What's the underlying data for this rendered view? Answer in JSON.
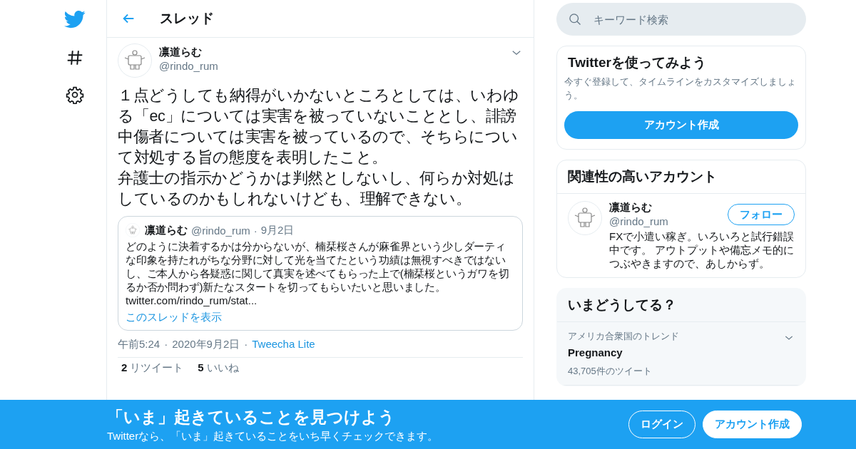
{
  "nav": [
    {
      "kind": "logo"
    },
    {
      "kind": "explore"
    },
    {
      "kind": "settings"
    }
  ],
  "header": {
    "title": "スレッド"
  },
  "tweet": {
    "name": "凛道らむ",
    "handle": "@rindo_rum",
    "paragraphs": [
      "１点どうしても納得がいかないところとしては、いわゆる「ec」については実害を被っていないこととし、誹謗中傷者については実害を被っているので、そちらについて対処する旨の態度を表明したこと。",
      "弁護士の指示かどうかは判然としないし、何らか対処はしているのかもしれないけども、理解できない。"
    ],
    "separator": "·",
    "quote": {
      "name": "凛道らむ",
      "handle": "@rindo_rum",
      "date": "9月2日",
      "text": "どのように決着するかは分からないが、楠栞桜さんが麻雀界という少しダーティな印象を持たれがちな分野に対して光を当てたという功績は無視すべきではないし、ご本人から各疑惑に関して真実を述べてもらった上で(楠栞桜というガワを切るか否か問わず)新たなスタートを切ってもらいたいと思いました。",
      "link": "twitter.com/rindo_rum/stat...",
      "thread_link": "このスレッドを表示"
    },
    "time": "午前5:24",
    "date": "2020年9月2日",
    "source": "Tweecha Lite",
    "stats": [
      {
        "count": "2",
        "label": "リツイート"
      },
      {
        "count": "5",
        "label": "いいね"
      }
    ]
  },
  "search": {
    "placeholder": "キーワード検索"
  },
  "signup_card": {
    "title": "Twitterを使ってみよう",
    "text": "今すぐ登録して、タイムラインをカスタマイズしましょう。",
    "button": "アカウント作成"
  },
  "related": {
    "title": "関連性の高いアカウント",
    "accounts": [
      {
        "name": "凛道らむ",
        "handle": "@rindo_rum",
        "button": "フォロー",
        "bio": "FXで小遣い稼ぎ。いろいろと試行錯誤中です。 アウトプットや備忘メモ的につぶやきますので、あしからず。"
      }
    ]
  },
  "trends": {
    "title": "いまどうしてる？",
    "items": [
      {
        "context": "アメリカ合衆国のトレンド",
        "topic": "Pregnancy",
        "count": "43,705件のツイート"
      }
    ]
  },
  "banner": {
    "title": "「いま」起きていることを見つけよう",
    "subtitle": "Twitterなら、「いま」起きていることをいち早くチェックできます。",
    "login": "ログイン",
    "signup": "アカウント作成"
  }
}
